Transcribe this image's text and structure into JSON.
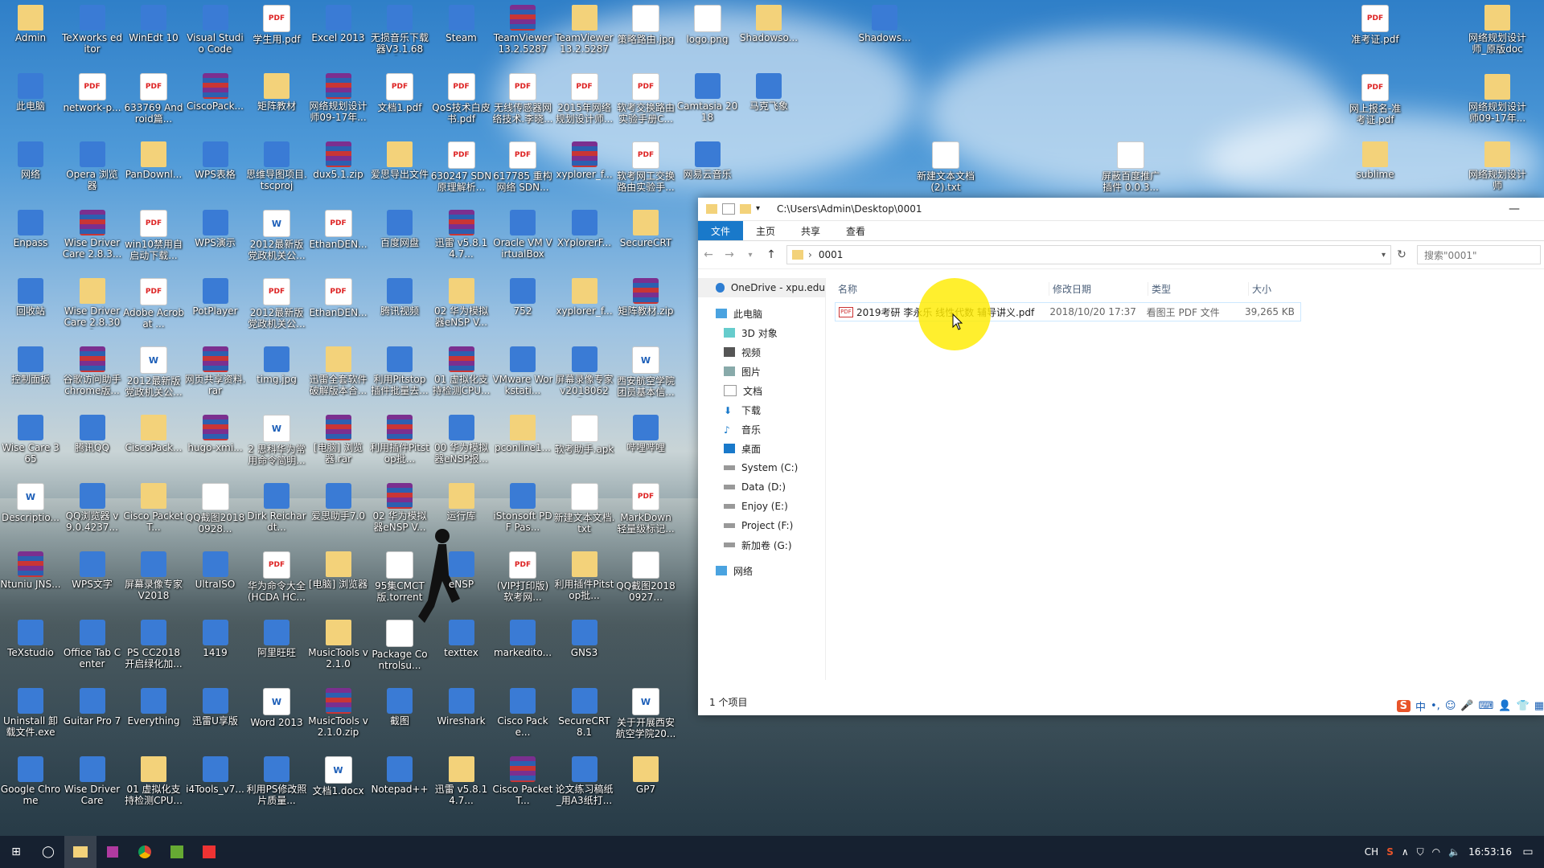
{
  "desktop": {
    "icons": [
      {
        "label": "Admin",
        "type": "folder"
      },
      {
        "label": "TeXworks editor",
        "type": "app"
      },
      {
        "label": "WinEdt 10",
        "type": "app"
      },
      {
        "label": "Visual Studio Code",
        "type": "app"
      },
      {
        "label": "学生用.pdf",
        "type": "pdf"
      },
      {
        "label": "Excel 2013",
        "type": "app"
      },
      {
        "label": "无损音乐下载器V3.1.684...",
        "type": "app"
      },
      {
        "label": "Steam",
        "type": "app"
      },
      {
        "label": "TeamViewer 13.2.5287 ...",
        "type": "rar"
      },
      {
        "label": "TeamViewer 13.2.5287 ...",
        "type": "folder"
      },
      {
        "label": "策略路由.jpg",
        "type": "txt"
      },
      {
        "label": "logo.png",
        "type": "txt"
      },
      {
        "label": "Shadowso...",
        "type": "folder"
      },
      {
        "label": "此电脑",
        "type": "app"
      },
      {
        "label": "network-p...",
        "type": "pdf"
      },
      {
        "label": "633769 Android篇...",
        "type": "pdf"
      },
      {
        "label": "CiscoPack...",
        "type": "rar"
      },
      {
        "label": "矩阵教材",
        "type": "folder"
      },
      {
        "label": "网络规划设计师09-17年...",
        "type": "rar"
      },
      {
        "label": "文档1.pdf",
        "type": "pdf"
      },
      {
        "label": "QoS技术白皮书.pdf",
        "type": "pdf"
      },
      {
        "label": "无线传感器网络技术.李晓...",
        "type": "pdf"
      },
      {
        "label": "2015年网络规划设计师...",
        "type": "pdf"
      },
      {
        "label": "软考交换路由实验手册C...",
        "type": "pdf"
      },
      {
        "label": "Camtasia 2018",
        "type": "app"
      },
      {
        "label": "马克飞象",
        "type": "app"
      },
      {
        "label": "网络",
        "type": "app"
      },
      {
        "label": "Opera 浏览器",
        "type": "app"
      },
      {
        "label": "PanDownl...",
        "type": "folder"
      },
      {
        "label": "WPS表格",
        "type": "app"
      },
      {
        "label": "思维导图项目.tscproj",
        "type": "app"
      },
      {
        "label": "dux5.1.zip",
        "type": "rar"
      },
      {
        "label": "爱思导出文件",
        "type": "folder"
      },
      {
        "label": "630247 SDN原理解析...",
        "type": "pdf"
      },
      {
        "label": "617785 重构网络 SDN...",
        "type": "pdf"
      },
      {
        "label": "xyplorer_f...",
        "type": "rar"
      },
      {
        "label": "软考网工交换路由实验手...",
        "type": "pdf"
      },
      {
        "label": "网易云音乐",
        "type": "app"
      },
      {
        "label": "Enpass",
        "type": "app"
      },
      {
        "label": "Wise Driver Care 2.8.3...",
        "type": "rar"
      },
      {
        "label": "win10禁用自启动下载...",
        "type": "pdf"
      },
      {
        "label": "WPS演示",
        "type": "app"
      },
      {
        "label": "2012最新版党政机关公...",
        "type": "doc"
      },
      {
        "label": "EthanDEN...",
        "type": "pdf"
      },
      {
        "label": "百度网盘",
        "type": "app"
      },
      {
        "label": "迅雷 v5.8.14.7...",
        "type": "rar"
      },
      {
        "label": "Oracle VM VirtualBox",
        "type": "app"
      },
      {
        "label": "XYplorerF...",
        "type": "app"
      },
      {
        "label": "SecureCRT",
        "type": "folder"
      },
      {
        "label": "回收站",
        "type": "app"
      },
      {
        "label": "Wise Driver Care 2.8.301",
        "type": "folder"
      },
      {
        "label": "Adobe Acrobat ...",
        "type": "pdf"
      },
      {
        "label": "PotPlayer",
        "type": "app"
      },
      {
        "label": "2012最新版党政机关公...",
        "type": "pdf"
      },
      {
        "label": "EthanDEN...",
        "type": "pdf"
      },
      {
        "label": "腾讯视频",
        "type": "app"
      },
      {
        "label": "02 华为模拟器eNSP V...",
        "type": "folder"
      },
      {
        "label": "752",
        "type": "app"
      },
      {
        "label": "xyplorer_f...",
        "type": "folder"
      },
      {
        "label": "矩阵教材.zip",
        "type": "rar"
      },
      {
        "label": "控制面板",
        "type": "app"
      },
      {
        "label": "谷歌访问助手chrome版...",
        "type": "rar"
      },
      {
        "label": "2012最新版党政机关公...",
        "type": "doc"
      },
      {
        "label": "网页共享资料.rar",
        "type": "rar"
      },
      {
        "label": "timg.jpg",
        "type": "app"
      },
      {
        "label": "迅雷全套软件破解版本合...",
        "type": "folder"
      },
      {
        "label": "利用Pitstop插件批量去...",
        "type": "app"
      },
      {
        "label": "01 虚拟化支持检测CPU...",
        "type": "rar"
      },
      {
        "label": "VMware Workstati...",
        "type": "app"
      },
      {
        "label": "屏幕录像专家v20180628...",
        "type": "app"
      },
      {
        "label": "西安航空学院团员基本信...",
        "type": "doc"
      },
      {
        "label": "Wise Care 365",
        "type": "app"
      },
      {
        "label": "腾讯QQ",
        "type": "app"
      },
      {
        "label": "CiscoPack...",
        "type": "folder"
      },
      {
        "label": "hugo-xmi...",
        "type": "rar"
      },
      {
        "label": "2 思科华为常用命令简明...",
        "type": "doc"
      },
      {
        "label": "[电脑] 浏览器.rar",
        "type": "rar"
      },
      {
        "label": "利用插件Pitstop批...",
        "type": "rar"
      },
      {
        "label": "00 华为模拟器eNSP报...",
        "type": "app"
      },
      {
        "label": "pconline1...",
        "type": "folder"
      },
      {
        "label": "软考助手.apk",
        "type": "txt"
      },
      {
        "label": "哔哩哔哩",
        "type": "app"
      },
      {
        "label": "Descriptio...",
        "type": "doc"
      },
      {
        "label": "QQ浏览器 v9.0.4237...",
        "type": "app"
      },
      {
        "label": "Cisco Packet T...",
        "type": "folder"
      },
      {
        "label": "QQ截图20180928...",
        "type": "txt"
      },
      {
        "label": "Dirk Reichardt...",
        "type": "app"
      },
      {
        "label": "爱思助手7.0",
        "type": "app"
      },
      {
        "label": "02 华为模拟器eNSP V...",
        "type": "rar"
      },
      {
        "label": "运行库",
        "type": "folder"
      },
      {
        "label": "iStonsoft PDF Pas...",
        "type": "app"
      },
      {
        "label": "新建文本文档.txt",
        "type": "txt"
      },
      {
        "label": "MarkDown 轻量级标记...",
        "type": "pdf"
      },
      {
        "label": "Ntuniu JNS...",
        "type": "rar"
      },
      {
        "label": "WPS文字",
        "type": "app"
      },
      {
        "label": "屏幕录像专家 V2018",
        "type": "app"
      },
      {
        "label": "UltraISO",
        "type": "app"
      },
      {
        "label": "华为命令大全(HCDA HC...",
        "type": "pdf"
      },
      {
        "label": "[电脑] 浏览器",
        "type": "folder"
      },
      {
        "label": "95集CMCT版.torrent",
        "type": "txt"
      },
      {
        "label": "eNSP",
        "type": "app"
      },
      {
        "label": "(VIP打印版) 软考网...",
        "type": "pdf"
      },
      {
        "label": "利用插件Pitstop批...",
        "type": "folder"
      },
      {
        "label": "QQ截图20180927...",
        "type": "txt"
      },
      {
        "label": "TeXstudio",
        "type": "app"
      },
      {
        "label": "Office Tab Center",
        "type": "app"
      },
      {
        "label": "PS CC2018 开启绿化加...",
        "type": "app"
      },
      {
        "label": "1419",
        "type": "app"
      },
      {
        "label": "阿里旺旺",
        "type": "app"
      },
      {
        "label": "MusicTools v2.1.0",
        "type": "folder"
      },
      {
        "label": "Package Controlsu...",
        "type": "txt"
      },
      {
        "label": "texttex",
        "type": "app"
      },
      {
        "label": "markedito...",
        "type": "app"
      },
      {
        "label": "GNS3",
        "type": "app"
      },
      {
        "label": "Uninstall 卸载文件.exe",
        "type": "app"
      },
      {
        "label": "Guitar Pro 7",
        "type": "app"
      },
      {
        "label": "Everything",
        "type": "app"
      },
      {
        "label": "迅雷U享版",
        "type": "app"
      },
      {
        "label": "Word 2013",
        "type": "doc"
      },
      {
        "label": "MusicTools v2.1.0.zip",
        "type": "rar"
      },
      {
        "label": "截图",
        "type": "app"
      },
      {
        "label": "Wireshark",
        "type": "app"
      },
      {
        "label": "Cisco Packe...",
        "type": "app"
      },
      {
        "label": "SecureCRT 8.1",
        "type": "app"
      },
      {
        "label": "关于开展西安航空学院20...",
        "type": "doc"
      },
      {
        "label": "Google Chrome",
        "type": "app"
      },
      {
        "label": "Wise Driver Care",
        "type": "app"
      },
      {
        "label": "01 虚拟化支持检测CPU...",
        "type": "folder"
      },
      {
        "label": "i4Tools_v7...",
        "type": "app"
      },
      {
        "label": "利用PS修改照片质量...",
        "type": "app"
      },
      {
        "label": "文档1.docx",
        "type": "doc"
      },
      {
        "label": "Notepad++",
        "type": "app"
      },
      {
        "label": "迅雷 v5.8.14.7...",
        "type": "folder"
      },
      {
        "label": "Cisco Packet T...",
        "type": "rar"
      },
      {
        "label": "论文练习稿纸_用A3纸打...",
        "type": "app"
      },
      {
        "label": "GP7",
        "type": "folder"
      }
    ],
    "right_icons": [
      {
        "label": "Shadows...",
        "type": "app"
      },
      {
        "label": "准考证.pdf",
        "type": "pdf"
      },
      {
        "label": "网络规划设计师_原版doc",
        "type": "folder"
      },
      {
        "label": "网上报名-准考证.pdf",
        "type": "pdf"
      },
      {
        "label": "网络规划设计师09-17年...",
        "type": "folder"
      },
      {
        "label": "新建文本文档 (2).txt",
        "type": "txt"
      },
      {
        "label": "屏蔽百度推广插件 0.0.3...",
        "type": "txt"
      },
      {
        "label": "sublime",
        "type": "folder"
      },
      {
        "label": "网络规划设计师",
        "type": "folder"
      }
    ]
  },
  "explorer": {
    "title_path": "C:\\Users\\Admin\\Desktop\\0001",
    "ribbon_tabs": [
      "文件",
      "主页",
      "共享",
      "查看"
    ],
    "address": "0001",
    "search_placeholder": "搜索\"0001\"",
    "nav": [
      {
        "label": "OneDrive - xpu.edu",
        "icon": "cloud-icon"
      },
      {
        "label": "此电脑",
        "icon": "computer-icon"
      },
      {
        "label": "3D 对象",
        "icon": "cube-icon"
      },
      {
        "label": "视频",
        "icon": "video-icon"
      },
      {
        "label": "图片",
        "icon": "picture-icon"
      },
      {
        "label": "文档",
        "icon": "document-icon"
      },
      {
        "label": "下载",
        "icon": "download-icon"
      },
      {
        "label": "音乐",
        "icon": "music-icon"
      },
      {
        "label": "桌面",
        "icon": "desktop-icon"
      },
      {
        "label": "System (C:)",
        "icon": "drive-icon"
      },
      {
        "label": "Data (D:)",
        "icon": "drive-icon"
      },
      {
        "label": "Enjoy (E:)",
        "icon": "drive-icon"
      },
      {
        "label": "Project (F:)",
        "icon": "drive-icon"
      },
      {
        "label": "新加卷 (G:)",
        "icon": "drive-icon"
      },
      {
        "label": "网络",
        "icon": "network-icon"
      }
    ],
    "columns": [
      "名称",
      "修改日期",
      "类型",
      "大小"
    ],
    "files": [
      {
        "name": "2019考研 李永乐 线性代数 辅导讲义.pdf",
        "date": "2018/10/20 17:37",
        "type": "看图王 PDF 文件",
        "size": "39,265 KB"
      }
    ],
    "status": "1 个项目",
    "ime": [
      "中",
      "•,",
      "☺",
      "🎤",
      "⌨",
      "👤",
      "👕",
      "▦"
    ]
  },
  "taskbar": {
    "tray_lang": "CH",
    "time": "16:53:16"
  },
  "colors": {
    "accent": "#1979ca",
    "highlight": "#ffeb00"
  }
}
